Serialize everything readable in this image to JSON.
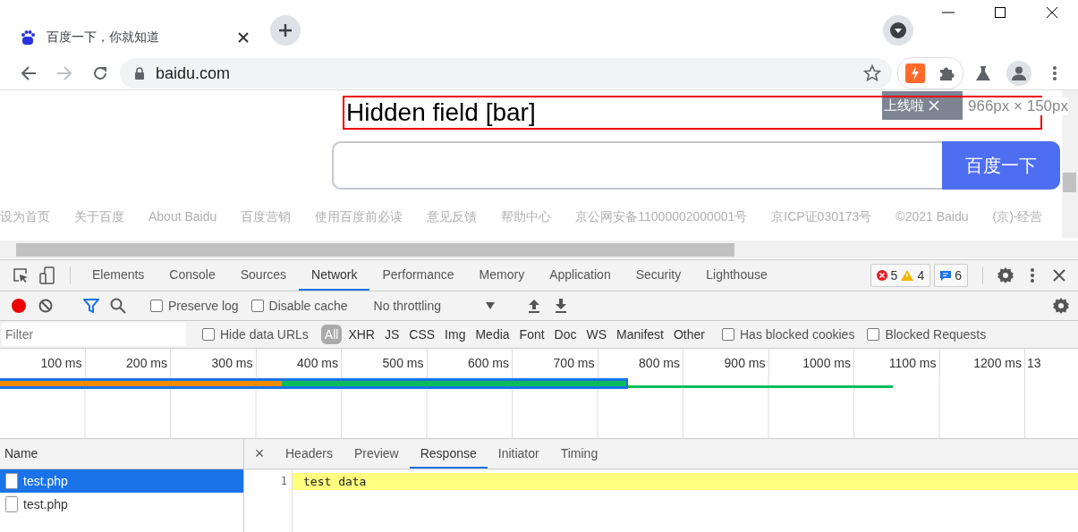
{
  "browser_tabs": [
    {
      "title": "百度一下，你就知道",
      "selected": true
    }
  ],
  "address_bar": {
    "url": "baidu.com"
  },
  "nav": {
    "forward_disabled": true
  },
  "page": {
    "highlight_label": "Hidden field [bar]",
    "tooltip": "上线啦",
    "size_label": "966px × 150px",
    "search_button": "百度一下",
    "footer_links": [
      "设为首页",
      "关于百度",
      "About Baidu",
      "百度营销",
      "使用百度前必读",
      "意见反馈",
      "帮助中心",
      "京公网安备11000002000001号",
      "京ICP证030173号",
      "©2021 Baidu",
      "(京)-经营"
    ]
  },
  "devtools": {
    "tabs": [
      {
        "label": "Elements",
        "selected": false
      },
      {
        "label": "Console",
        "selected": false
      },
      {
        "label": "Sources",
        "selected": false
      },
      {
        "label": "Network",
        "selected": true
      },
      {
        "label": "Performance",
        "selected": false
      },
      {
        "label": "Memory",
        "selected": false
      },
      {
        "label": "Application",
        "selected": false
      },
      {
        "label": "Security",
        "selected": false
      },
      {
        "label": "Lighthouse",
        "selected": false
      }
    ],
    "errors": "5",
    "warnings": "4",
    "messages": "6",
    "toolbar": {
      "recording": true,
      "filter_on": true,
      "preserve_log": {
        "label": "Preserve log",
        "checked": false
      },
      "disable_cache": {
        "label": "Disable cache",
        "checked": false
      },
      "throttling": "No throttling"
    },
    "filter": {
      "placeholder": "Filter",
      "hide_data_urls": {
        "label": "Hide data URLs",
        "checked": false
      },
      "types": [
        {
          "label": "All",
          "selected": true
        },
        {
          "label": "XHR",
          "selected": false
        },
        {
          "label": "JS",
          "selected": false
        },
        {
          "label": "CSS",
          "selected": false
        },
        {
          "label": "Img",
          "selected": false
        },
        {
          "label": "Media",
          "selected": false
        },
        {
          "label": "Font",
          "selected": false
        },
        {
          "label": "Doc",
          "selected": false
        },
        {
          "label": "WS",
          "selected": false
        },
        {
          "label": "Manifest",
          "selected": false
        },
        {
          "label": "Other",
          "selected": false
        }
      ],
      "has_blocked_cookies": {
        "label": "Has blocked cookies",
        "checked": false
      },
      "blocked_requests": {
        "label": "Blocked Requests",
        "checked": false
      }
    },
    "timeline_ticks": [
      "100 ms",
      "200 ms",
      "300 ms",
      "400 ms",
      "500 ms",
      "600 ms",
      "700 ms",
      "800 ms",
      "900 ms",
      "1000 ms",
      "1100 ms",
      "1200 ms",
      "13"
    ],
    "name_header": "Name",
    "requests": [
      {
        "name": "test.php",
        "selected": true
      },
      {
        "name": "test.php",
        "selected": false
      }
    ],
    "detail_tabs": [
      {
        "label": "Headers",
        "selected": false
      },
      {
        "label": "Preview",
        "selected": false
      },
      {
        "label": "Response",
        "selected": true
      },
      {
        "label": "Initiator",
        "selected": false
      },
      {
        "label": "Timing",
        "selected": false
      }
    ],
    "close_icon": "×",
    "response_lines": [
      {
        "number": "1",
        "text": "test data"
      }
    ]
  }
}
